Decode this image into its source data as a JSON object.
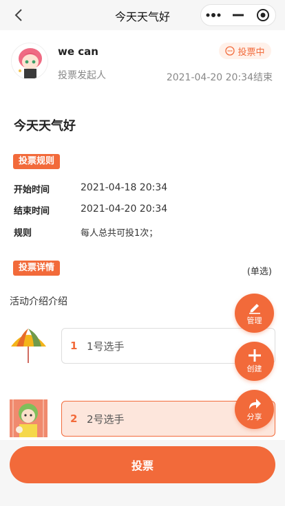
{
  "nav": {
    "title": "今天天气好"
  },
  "creator": {
    "name": "we can",
    "role": "投票发起人"
  },
  "status": {
    "label": "投票中"
  },
  "end_time": "2021-04-20 20:34结束",
  "vote_title": "今天天气好",
  "rules": {
    "tag": "投票规则",
    "items": [
      {
        "key": "开始时间",
        "value": "2021-04-18 20:34"
      },
      {
        "key": "结束时间",
        "value": "2021-04-20 20:34"
      },
      {
        "key": "规则",
        "value": "每人总共可投1次；"
      }
    ]
  },
  "details": {
    "tag": "投票详情",
    "mode": "(单选)",
    "intro": "活动介绍介绍"
  },
  "options": [
    {
      "num": "1",
      "label": "1号选手",
      "selected": false
    },
    {
      "num": "2",
      "label": "2号选手",
      "selected": true
    }
  ],
  "fabs": {
    "manage": "管理",
    "create": "创建",
    "share": "分享"
  },
  "submit_label": "投票",
  "colors": {
    "accent": "#f26a3a",
    "selected_bg": "#fde6dc"
  }
}
